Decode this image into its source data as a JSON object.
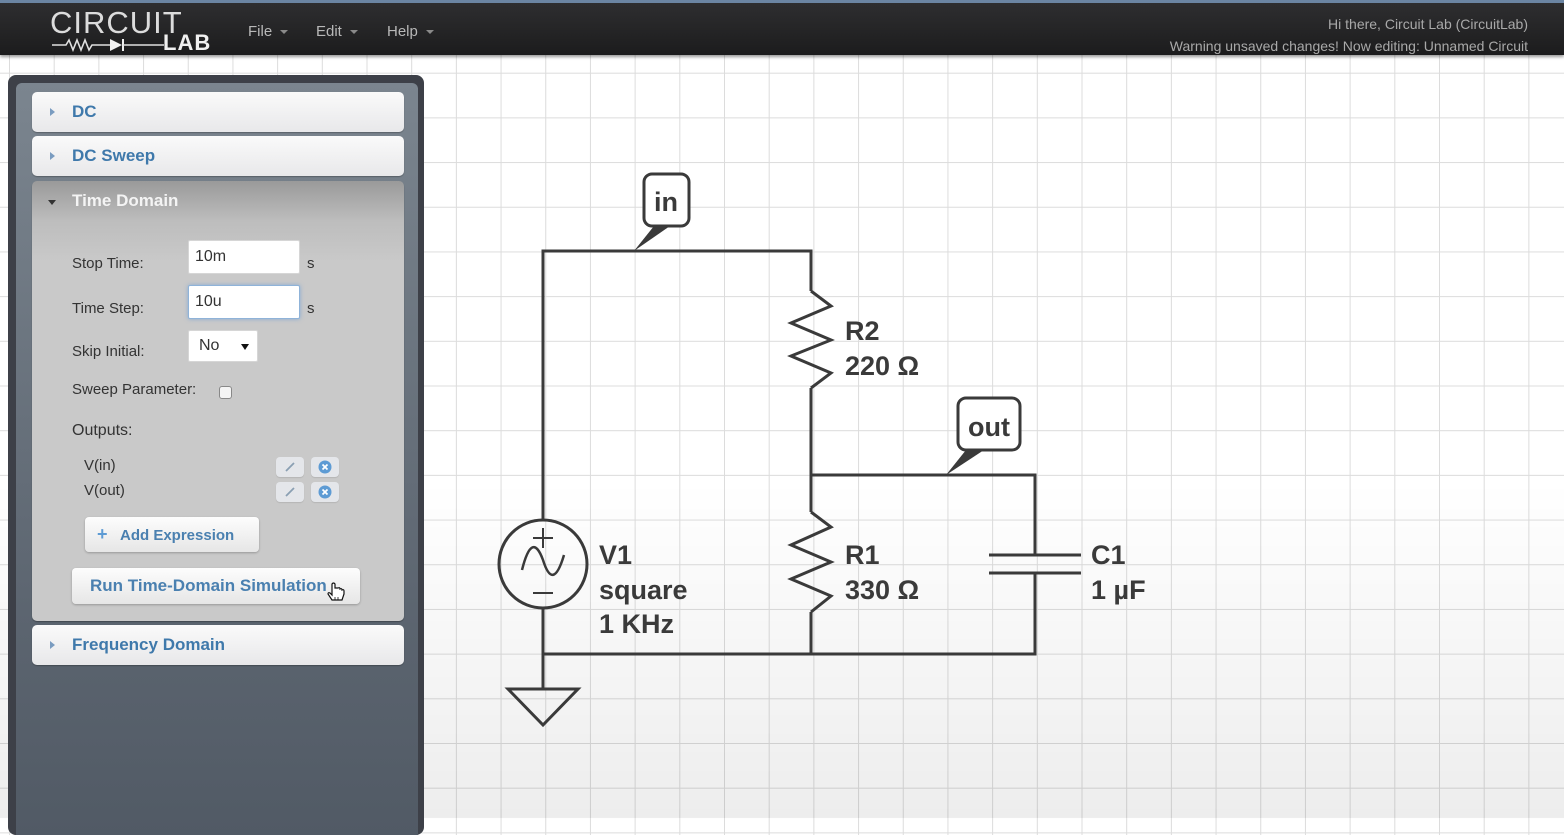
{
  "app": {
    "logo_top": "CIRCUIT",
    "logo_bottom": "LAB",
    "menu": [
      {
        "label": "File"
      },
      {
        "label": "Edit"
      },
      {
        "label": "Help"
      }
    ],
    "greeting": "Hi there, Circuit Lab (CircuitLab)",
    "status": "Warning unsaved changes! Now editing: Unnamed Circuit"
  },
  "sidebar": {
    "sections": [
      {
        "label": "DC",
        "expanded": false
      },
      {
        "label": "DC Sweep",
        "expanded": false
      },
      {
        "label": "Time Domain",
        "expanded": true
      },
      {
        "label": "Frequency Domain",
        "expanded": false
      }
    ],
    "time_domain": {
      "stop_time_label": "Stop Time:",
      "stop_time_value": "10m",
      "stop_time_unit": "s",
      "time_step_label": "Time Step:",
      "time_step_value": "10u",
      "time_step_unit": "s",
      "skip_initial_label": "Skip Initial:",
      "skip_initial_value": "No",
      "sweep_parameter_label": "Sweep Parameter:",
      "sweep_parameter_checked": false,
      "outputs_label": "Outputs:",
      "outputs": [
        {
          "expr": "V(in)"
        },
        {
          "expr": "V(out)"
        }
      ],
      "add_expression_label": "Add Expression",
      "run_button_label": "Run Time-Domain Simulation"
    }
  },
  "circuit": {
    "nodes": [
      {
        "label": "in"
      },
      {
        "label": "out"
      }
    ],
    "components": {
      "V1": {
        "name": "V1",
        "type": "square",
        "freq": "1 KHz"
      },
      "R2": {
        "name": "R2",
        "value": "220 Ω"
      },
      "R1": {
        "name": "R1",
        "value": "330 Ω"
      },
      "C1": {
        "name": "C1",
        "value": "1 µF"
      }
    }
  }
}
